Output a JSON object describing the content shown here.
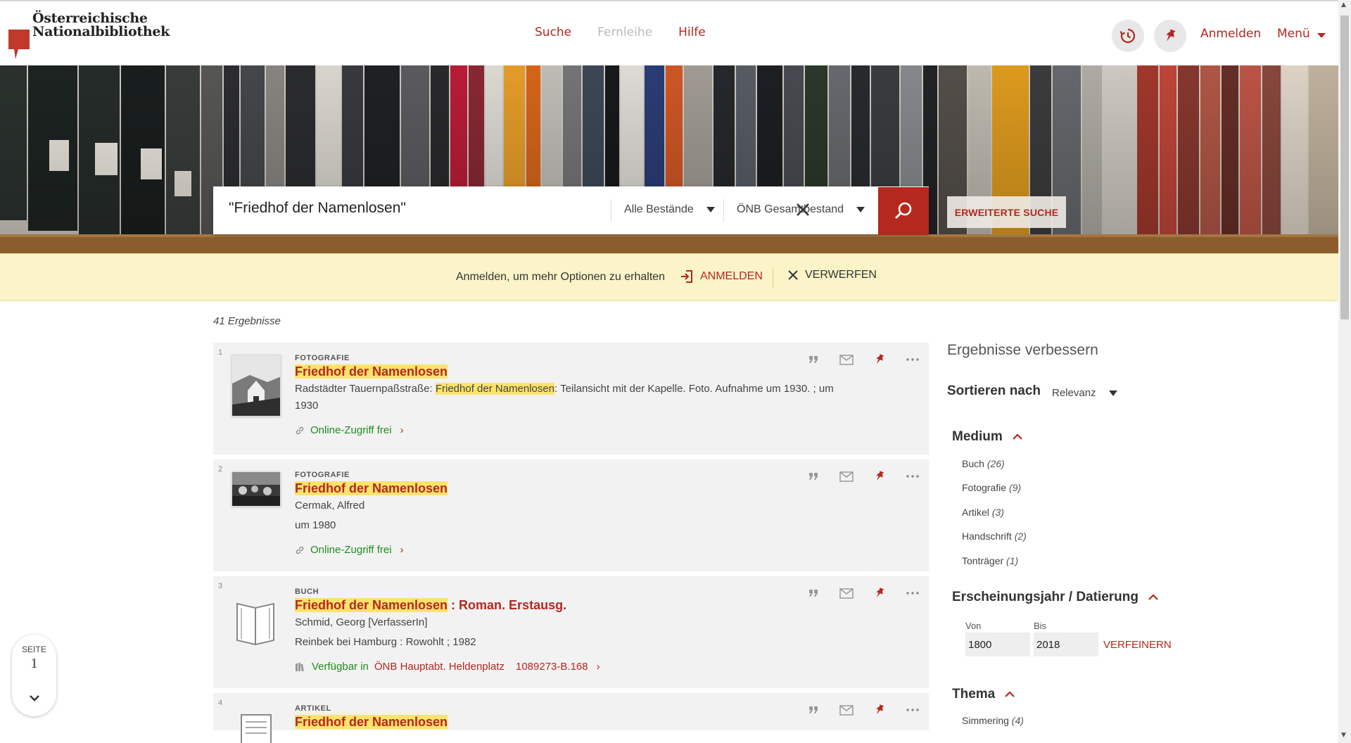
{
  "brand": {
    "line1": "Österreichische",
    "line2": "Nationalbibliothek"
  },
  "nav": {
    "search": "Suche",
    "ill": "Fernleihe",
    "help": "Hilfe"
  },
  "header": {
    "login": "Anmelden",
    "menu": "Menü"
  },
  "search": {
    "query": "\"Friedhof der Namenlosen\"",
    "scope": "Alle Bestände",
    "collection": "ÖNB Gesamtbestand",
    "advanced": "ERWEITERTE SUCHE"
  },
  "notice": {
    "message": "Anmelden, um mehr Optionen zu erhalten",
    "login": "ANMELDEN",
    "dismiss": "VERWERFEN"
  },
  "results": {
    "count": "41 Ergebnisse",
    "items": [
      {
        "num": "1",
        "type": "FOTOGRAFIE",
        "title_hl": "Friedhof der Namenlosen",
        "title_rest": "",
        "desc_pre": "Radstädter Tauernpaßstraße: ",
        "desc_hl": "Friedhof der Namenlosen",
        "desc_post": ": Teilansicht mit der Kapelle. Foto. Aufnahme um 1930. ; um",
        "desc_cont": "1930",
        "availability": "Online-Zugriff frei"
      },
      {
        "num": "2",
        "type": "FOTOGRAFIE",
        "title_hl": "Friedhof der Namenlosen",
        "title_rest": "",
        "author": "Cermak, Alfred",
        "date": "um 1980",
        "availability": "Online-Zugriff frei"
      },
      {
        "num": "3",
        "type": "BUCH",
        "title_hl": "Friedhof der Namenlosen",
        "title_rest": " : Roman. Erstausg.",
        "author": "Schmid, Georg [VerfasserIn]",
        "publisher": "Reinbek bei Hamburg : Rowohlt ; 1982",
        "availability": "Verfügbar in",
        "location": "ÖNB Hauptabt. Heldenplatz",
        "shelfmark": "1089273-B.168"
      },
      {
        "num": "4",
        "type": "ARTIKEL",
        "title_hl": "Friedhof der Namenlosen"
      }
    ]
  },
  "facets": {
    "title": "Ergebnisse verbessern",
    "sort_label": "Sortieren nach",
    "sort_value": "Relevanz",
    "medium": {
      "label": "Medium",
      "items": [
        {
          "name": "Buch",
          "count": "(26)"
        },
        {
          "name": "Fotografie",
          "count": "(9)"
        },
        {
          "name": "Artikel",
          "count": "(3)"
        },
        {
          "name": "Handschrift",
          "count": "(2)"
        },
        {
          "name": "Tonträger",
          "count": "(1)"
        }
      ]
    },
    "year": {
      "label": "Erscheinungsjahr / Datierung",
      "from_label": "Von",
      "to_label": "Bis",
      "from": "1800",
      "to": "2018",
      "refine": "VERFEINERN"
    },
    "topic": {
      "label": "Thema",
      "items": [
        {
          "name": "Simmering",
          "count": "(4)"
        }
      ]
    }
  },
  "pager": {
    "label": "SEITE",
    "page": "1"
  },
  "colors": {
    "accent": "#b5281f",
    "highlight": "#fce36c",
    "notice": "#faf4c8",
    "green": "#1f8c1f"
  }
}
